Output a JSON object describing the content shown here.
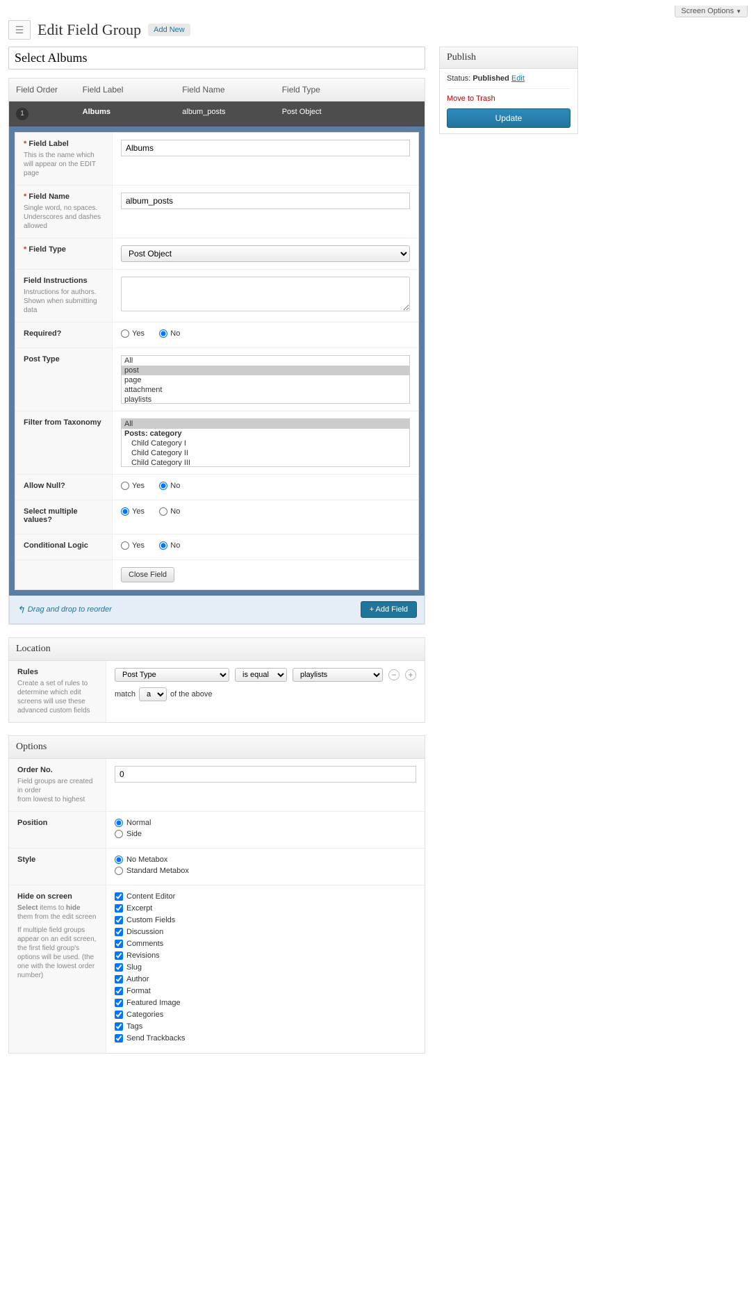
{
  "screen_options": "Screen Options",
  "header": {
    "title": "Edit Field Group",
    "add_new": "Add New"
  },
  "group_title": "Select Albums",
  "columns": {
    "order": "Field Order",
    "label": "Field Label",
    "name": "Field Name",
    "type": "Field Type"
  },
  "field_row": {
    "order": "1",
    "label": "Albums",
    "name": "album_posts",
    "type": "Post Object"
  },
  "form": {
    "field_label": {
      "label": "Field Label",
      "desc": "This is the name which will appear on the EDIT page",
      "value": "Albums"
    },
    "field_name": {
      "label": "Field Name",
      "desc": "Single word, no spaces. Underscores and dashes allowed",
      "value": "album_posts"
    },
    "field_type": {
      "label": "Field Type",
      "value": "Post Object"
    },
    "instructions": {
      "label": "Field Instructions",
      "desc": "Instructions for authors. Shown when submitting data",
      "value": ""
    },
    "required": {
      "label": "Required?",
      "yes": "Yes",
      "no": "No",
      "value": "No"
    },
    "post_type": {
      "label": "Post Type",
      "options": [
        "All",
        "post",
        "page",
        "attachment",
        "playlists"
      ],
      "selected": "post"
    },
    "filter_tax": {
      "label": "Filter from Taxonomy",
      "group": "Posts: category",
      "options_top": "All",
      "options": [
        "Child Category I",
        "Child Category II",
        "Child Category III"
      ],
      "selected": "All"
    },
    "allow_null": {
      "label": "Allow Null?",
      "yes": "Yes",
      "no": "No",
      "value": "No"
    },
    "multiple": {
      "label": "Select multiple values?",
      "yes": "Yes",
      "no": "No",
      "value": "Yes"
    },
    "conditional": {
      "label": "Conditional Logic",
      "yes": "Yes",
      "no": "No",
      "value": "No"
    },
    "close": "Close Field"
  },
  "footer": {
    "hint": "Drag and drop to reorder",
    "add": "+ Add Field"
  },
  "location": {
    "title": "Location",
    "rules_label": "Rules",
    "rules_desc": "Create a set of rules to determine which edit screens will use these advanced custom fields",
    "param": "Post Type",
    "operator": "is equal to",
    "value": "playlists",
    "match_pre": "match",
    "match_val": "all",
    "match_post": "of the above"
  },
  "options": {
    "title": "Options",
    "order": {
      "label": "Order No.",
      "desc1": "Field groups are created in order",
      "desc2": "from lowest to highest",
      "value": "0"
    },
    "position": {
      "label": "Position",
      "normal": "Normal",
      "side": "Side",
      "value": "Normal"
    },
    "style": {
      "label": "Style",
      "no_meta": "No Metabox",
      "std_meta": "Standard Metabox",
      "value": "No Metabox"
    },
    "hide": {
      "label": "Hide on screen",
      "desc1": "Select items to hide them from the edit screen",
      "desc2": "If multiple field groups appear on an edit screen, the first field group's options will be used. (the one with the lowest order number)",
      "items": [
        "Content Editor",
        "Excerpt",
        "Custom Fields",
        "Discussion",
        "Comments",
        "Revisions",
        "Slug",
        "Author",
        "Format",
        "Featured Image",
        "Categories",
        "Tags",
        "Send Trackbacks"
      ]
    }
  },
  "publish": {
    "title": "Publish",
    "status_label": "Status:",
    "status_value": "Published",
    "edit": "Edit",
    "trash": "Move to Trash",
    "update": "Update"
  }
}
